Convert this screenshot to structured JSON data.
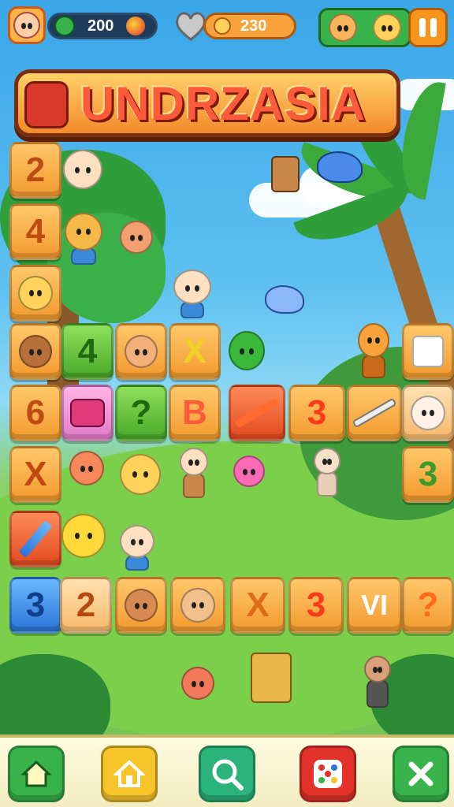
{
  "hud": {
    "coins": "200",
    "gems": "230",
    "coin_icon": "clover-coin-icon",
    "gem_icon": "coin-icon",
    "heart_icon": "heart-icon",
    "pause_icon": "pause-icon"
  },
  "title": {
    "text": "UNDRZASIA"
  },
  "board": {
    "left_column": [
      "2",
      "4",
      "",
      "",
      "6",
      "X",
      ""
    ],
    "row_mid_top": [
      "4",
      "",
      "X",
      ""
    ],
    "row_mid": [
      "",
      "",
      "B",
      "",
      "3",
      "",
      ""
    ],
    "right_column": [
      "",
      "",
      "3"
    ],
    "bottom_row": [
      "3",
      "2",
      "",
      "",
      "X",
      "3",
      "VI",
      "?"
    ]
  },
  "bottom_nav": [
    {
      "icon": "home-icon",
      "color": "#38b34a"
    },
    {
      "icon": "house-outline-icon",
      "color": "#f7c52a"
    },
    {
      "icon": "search-icon",
      "color": "#2ab37a"
    },
    {
      "icon": "dice-icon",
      "color": "#e2322a"
    },
    {
      "icon": "close-icon",
      "color": "#38b34a"
    }
  ]
}
